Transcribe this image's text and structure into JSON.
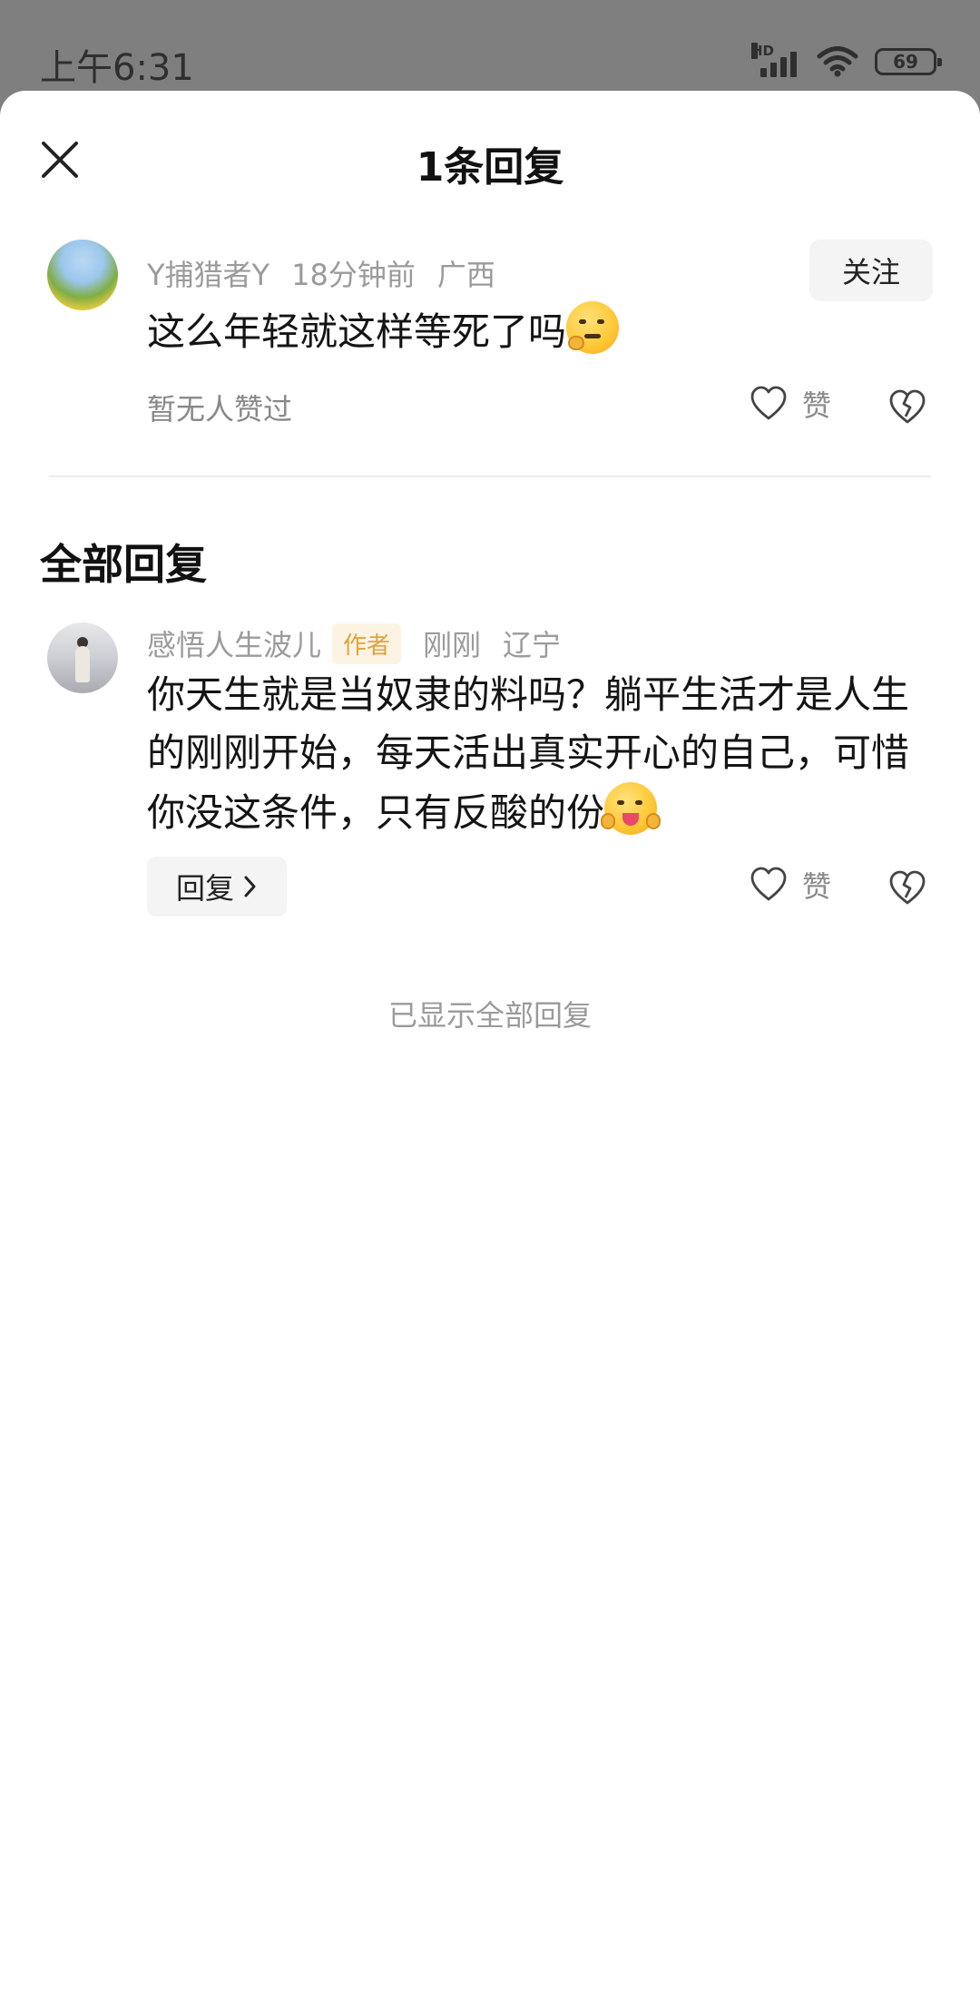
{
  "status_bar": {
    "time": "上午6:31",
    "network_label": "HD",
    "battery": "69"
  },
  "sheet": {
    "title": "1条回复"
  },
  "root_comment": {
    "username": "Y捕猎者Y",
    "time": "18分钟前",
    "location": "广西",
    "text": "这么年轻就这样等死了吗",
    "emoji": "thinking-face-emoji",
    "follow_label": "关注",
    "likes_status": "暂无人赞过",
    "like_label": "赞"
  },
  "replies_section": {
    "title": "全部回复"
  },
  "replies": [
    {
      "username": "感悟人生波儿",
      "badge": "作者",
      "time": "刚刚",
      "location": "辽宁",
      "text": "你天生就是当奴隶的料吗？躺平生活才是人生的刚刚开始，每天活出真实开心的自己，可惜你没这条件，只有反酸的份",
      "emoji": "squinting-face-with-tongue-emoji",
      "reply_label": "回复",
      "like_label": "赞"
    }
  ],
  "footer": {
    "note": "已显示全部回复"
  }
}
